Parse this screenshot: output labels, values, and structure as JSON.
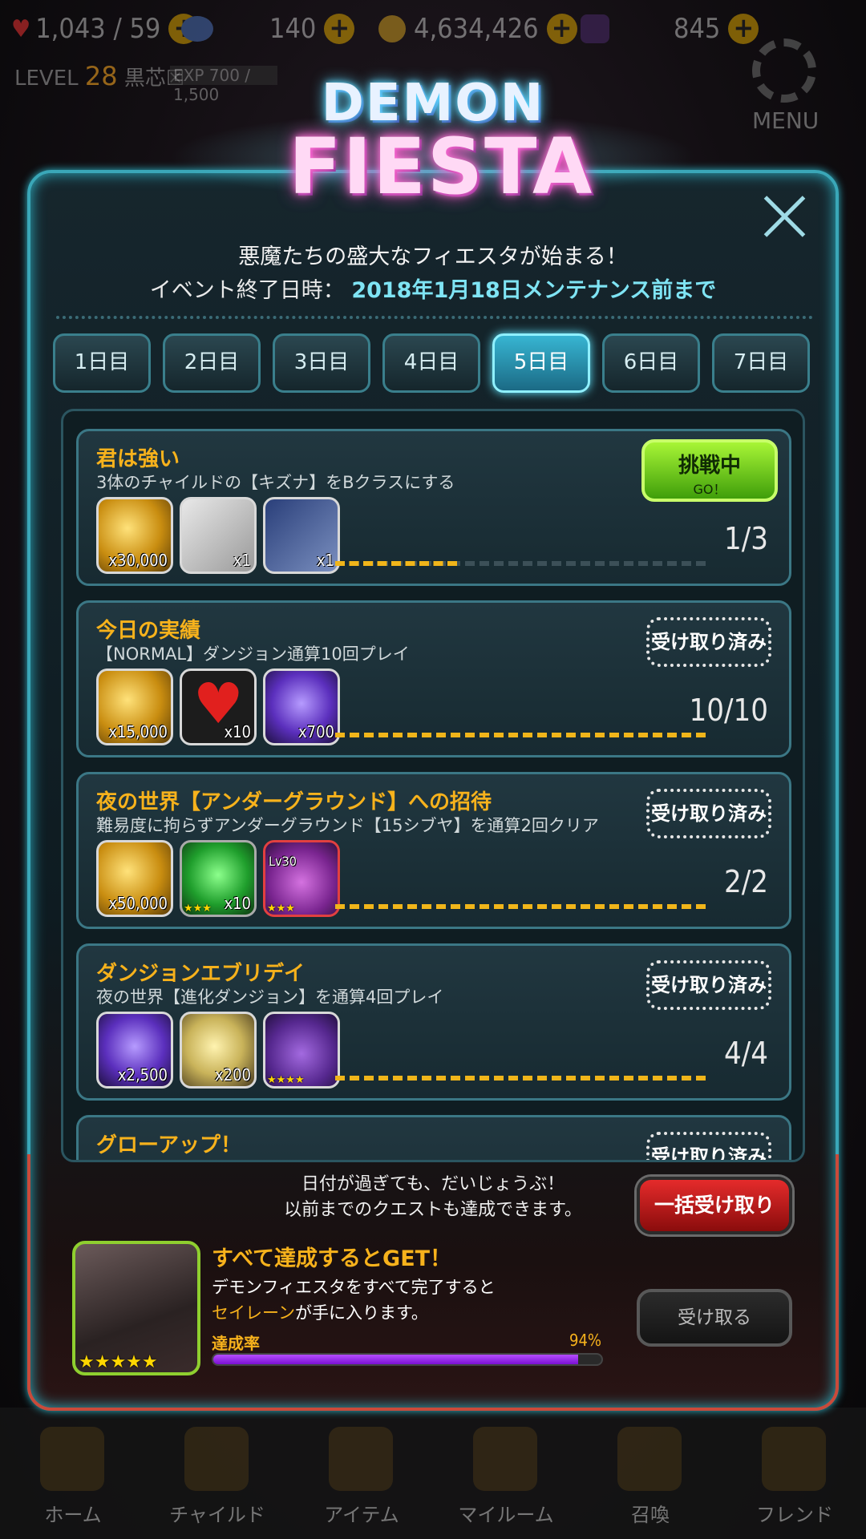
{
  "topbar": {
    "stamina": "1,043 / 59",
    "gems": "140",
    "gold": "4,634,426",
    "soul": "845"
  },
  "player": {
    "level_label": "LEVEL",
    "level": "28",
    "name": "黒芯☒",
    "exp": "EXP 700 / 1,500"
  },
  "menu_label": "MENU",
  "event": {
    "logo_line1": "DEMON",
    "logo_line2": "FIESTA",
    "subtitle": "悪魔たちの盛大なフィエスタが始まる！",
    "end_label": "イベント終了日時：",
    "end_value": "2018年1月18日メンテナンス前まで"
  },
  "tabs": [
    {
      "label": "1日目"
    },
    {
      "label": "2日目"
    },
    {
      "label": "3日目"
    },
    {
      "label": "4日目"
    },
    {
      "label": "5日目",
      "active": true
    },
    {
      "label": "6日目"
    },
    {
      "label": "7日目"
    }
  ],
  "missions": [
    {
      "title": "君は強い",
      "desc": "3体のチャイルドの【キズナ】をBクラスにする",
      "rewards": [
        {
          "icon": "gold-coins",
          "qty": "x30,000"
        },
        {
          "icon": "platinum-card",
          "qty": "x1"
        },
        {
          "icon": "ticket",
          "qty": "x1"
        }
      ],
      "progress": "1/3",
      "progress_ratio": 0.33,
      "status": "active",
      "button_l1": "挑戦中",
      "button_l2": "GO！"
    },
    {
      "title": "今日の実績",
      "desc": "【NORMAL】ダンジョン通算10回プレイ",
      "rewards": [
        {
          "icon": "gold-coins",
          "qty": "x15,000"
        },
        {
          "icon": "heart",
          "qty": "x10"
        },
        {
          "icon": "purple-gem",
          "qty": "x700"
        }
      ],
      "progress": "10/10",
      "progress_ratio": 1.0,
      "status": "done",
      "button": "受け取り済み"
    },
    {
      "title": "夜の世界【アンダーグラウンド】への招待",
      "desc": "難易度に拘らずアンダーグラウンド【15シブヤ】を通算2回クリア",
      "rewards": [
        {
          "icon": "gold-coins",
          "qty": "x50,000"
        },
        {
          "icon": "green-gem",
          "qty": "x10",
          "stars": "★★★"
        },
        {
          "icon": "monster-purple",
          "qty": "Lv30",
          "stars": "★★★"
        }
      ],
      "progress": "2/2",
      "progress_ratio": 1.0,
      "status": "done",
      "button": "受け取り済み"
    },
    {
      "title": "ダンジョンエブリデイ",
      "desc": "夜の世界【進化ダンジョン】を通算4回プレイ",
      "rewards": [
        {
          "icon": "purple-gem",
          "qty": "x2,500"
        },
        {
          "icon": "silver-coin",
          "qty": "x200"
        },
        {
          "icon": "monster-violet",
          "qty": "",
          "stars": "★★★★"
        }
      ],
      "progress": "4/4",
      "progress_ratio": 1.0,
      "status": "done",
      "button": "受け取り済み"
    },
    {
      "title": "グローアップ！",
      "desc": "",
      "rewards": [],
      "progress": "",
      "progress_ratio": 1.0,
      "status": "done",
      "button": "受け取り済み"
    }
  ],
  "footer": {
    "note_l1": "日付が過ぎても、だいじょうぶ！",
    "note_l2": "以前までのクエストも達成できます。",
    "bulk_button": "一括受け取り",
    "get_title": "すべて達成するとGET！",
    "get_desc_l1": "デモンフィエスタをすべて完了すると",
    "get_hl": "セイレーン",
    "get_desc_l2_rest": "が手に入ります。",
    "rate_label": "達成率",
    "rate_value": "94%",
    "rate_ratio": 0.94,
    "receive_button": "受け取る",
    "portrait_stars": "★★★★★"
  },
  "nav": [
    "ホーム",
    "チャイルド",
    "アイテム",
    "マイルーム",
    "召喚",
    "フレンド"
  ],
  "colors": {
    "accent_cyan": "#3aa7b8",
    "title_gold": "#f7b21c",
    "go_green": "#7fd61a",
    "bulk_red": "#d11f1f"
  }
}
